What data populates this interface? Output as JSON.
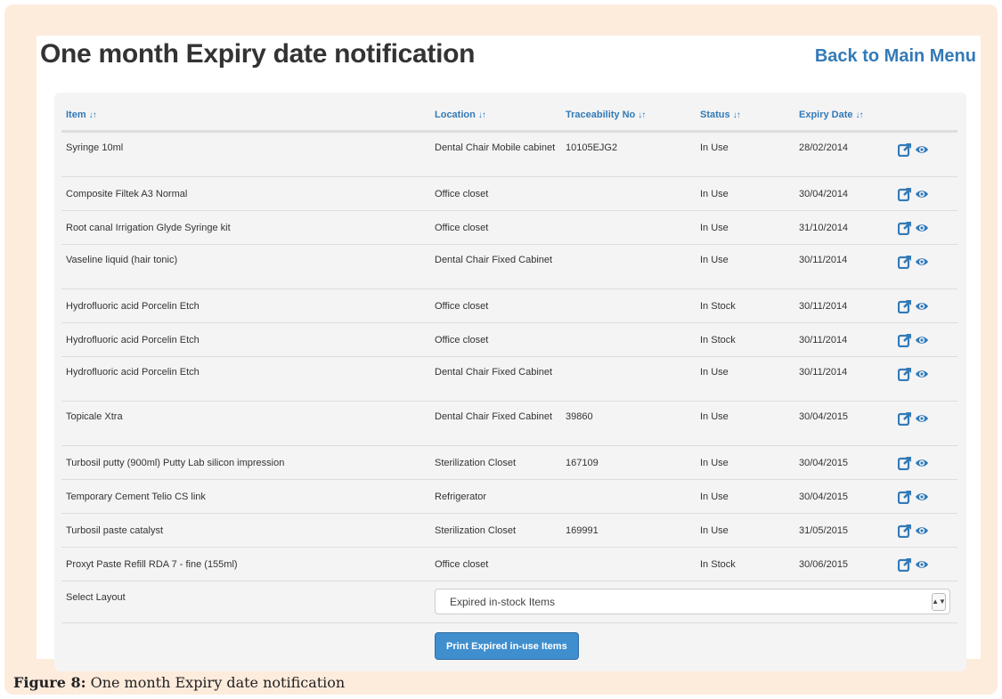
{
  "page": {
    "title": "One month Expiry date notification",
    "back_link": "Back to Main Menu"
  },
  "table": {
    "headers": {
      "item": "Item",
      "location": "Location",
      "traceability": "Traceability No",
      "status": "Status",
      "expiry": "Expiry Date"
    },
    "rows": [
      {
        "item": "Syringe 10ml",
        "location": "Dental Chair Mobile cabinet",
        "traceability": "10105EJG2",
        "status": "In Use",
        "expiry": "28/02/2014"
      },
      {
        "item": "Composite Filtek A3 Normal",
        "location": "Office closet",
        "traceability": "",
        "status": "In Use",
        "expiry": "30/04/2014"
      },
      {
        "item": "Root canal Irrigation Glyde Syringe kit",
        "location": "Office closet",
        "traceability": "",
        "status": "In Use",
        "expiry": "31/10/2014"
      },
      {
        "item": "Vaseline liquid (hair tonic)",
        "location": "Dental Chair Fixed Cabinet",
        "traceability": "",
        "status": "In Use",
        "expiry": "30/11/2014"
      },
      {
        "item": "Hydrofluoric acid Porcelin Etch",
        "location": "Office closet",
        "traceability": "",
        "status": "In Stock",
        "expiry": "30/11/2014"
      },
      {
        "item": "Hydrofluoric acid Porcelin Etch",
        "location": "Office closet",
        "traceability": "",
        "status": "In Stock",
        "expiry": "30/11/2014"
      },
      {
        "item": "Hydrofluoric acid Porcelin Etch",
        "location": "Dental Chair Fixed Cabinet",
        "traceability": "",
        "status": "In Use",
        "expiry": "30/11/2014"
      },
      {
        "item": "Topicale Xtra",
        "location": "Dental Chair Fixed Cabinet",
        "traceability": "39860",
        "status": "In Use",
        "expiry": "30/04/2015"
      },
      {
        "item": "Turbosil putty (900ml) Putty Lab silicon impression",
        "location": "Sterilization Closet",
        "traceability": "167109",
        "status": "In Use",
        "expiry": "30/04/2015"
      },
      {
        "item": "Temporary Cement Telio CS link",
        "location": "Refrigerator",
        "traceability": "",
        "status": "In Use",
        "expiry": "30/04/2015"
      },
      {
        "item": "Turbosil paste catalyst",
        "location": "Sterilization Closet",
        "traceability": "169991",
        "status": "In Use",
        "expiry": "31/05/2015"
      },
      {
        "item": "Proxyt Paste Refill RDA 7 - fine (155ml)",
        "location": "Office closet",
        "traceability": "",
        "status": "In Stock",
        "expiry": "30/06/2015"
      }
    ]
  },
  "layout": {
    "label": "Select Layout",
    "selected": "Expired in-stock Items"
  },
  "print_button": "Print Expired in-use Items",
  "caption": {
    "label": "Figure 8:",
    "text": "One month Expiry date notification"
  },
  "icons": {
    "sort": "sort-icon",
    "edit": "edit-external-icon",
    "view": "eye-icon"
  },
  "colors": {
    "accent": "#337ab7",
    "button": "#3f8fcf",
    "frame": "#fdebdc"
  }
}
